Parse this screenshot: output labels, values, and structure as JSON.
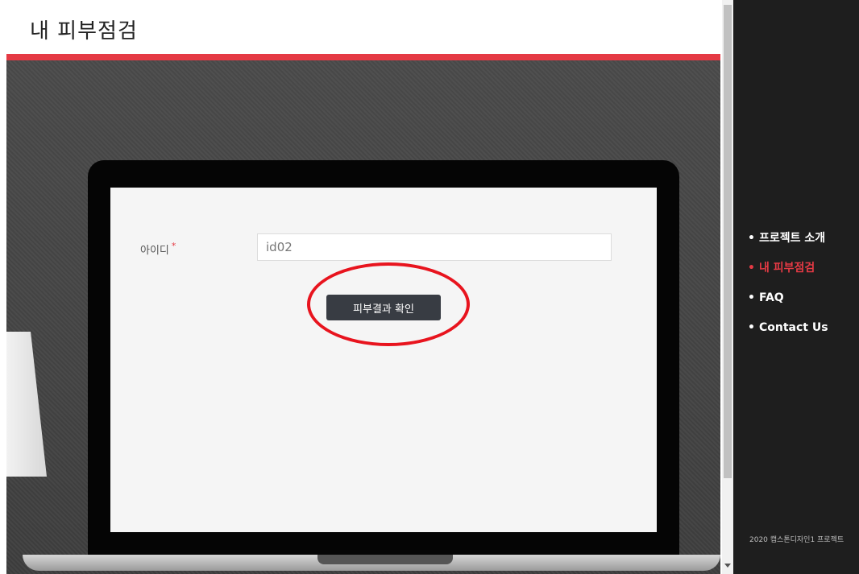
{
  "header": {
    "title": "내 피부점검"
  },
  "form": {
    "id_label": "아이디",
    "required_mark": "*",
    "id_value": "id02",
    "submit_label": "피부결과 확인"
  },
  "sidebar": {
    "bullet": "•",
    "items": [
      {
        "label": "프로젝트 소개"
      },
      {
        "label": "내 피부점검"
      },
      {
        "label": "FAQ"
      },
      {
        "label": "Contact Us"
      }
    ],
    "active_index": 1,
    "footer": "2020 캡스톤디자인1 프로젝트"
  },
  "colors": {
    "accent": "#e53a44",
    "sidebar_bg": "#1e1e1e",
    "button_bg": "#383c43",
    "annotation": "#e8141e"
  }
}
